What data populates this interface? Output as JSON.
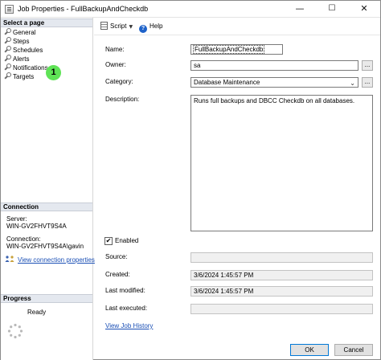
{
  "window": {
    "title": "Job Properties - FullBackupAndCheckdb",
    "minimize": "—",
    "maximize": "☐",
    "close": "✕"
  },
  "left": {
    "select_header": "Select a page",
    "pages": [
      {
        "label": "General"
      },
      {
        "label": "Steps"
      },
      {
        "label": "Schedules"
      },
      {
        "label": "Alerts"
      },
      {
        "label": "Notifications"
      },
      {
        "label": "Targets"
      }
    ],
    "badge": "1",
    "connection_header": "Connection",
    "server_label": "Server:",
    "server_value": "WIN-GV2FHVT9S4A",
    "connection_label": "Connection:",
    "connection_value": "WIN-GV2FHVT9S4A\\gavin",
    "view_connection": "View connection properties",
    "progress_header": "Progress",
    "progress_status": "Ready"
  },
  "toolbar": {
    "script": "Script",
    "help": "Help"
  },
  "form": {
    "name_label": "Name:",
    "name_value": "FullBackupAndCheckdb",
    "owner_label": "Owner:",
    "owner_value": "sa",
    "category_label": "Category:",
    "category_value": "Database Maintenance",
    "description_label": "Description:",
    "description_value": "Runs full backups and DBCC Checkdb on all databases.",
    "enabled_label": "Enabled",
    "enabled_checked": true,
    "enabled_mark": "✔",
    "source_label": "Source:",
    "source_value": "",
    "created_label": "Created:",
    "created_value": "3/6/2024 1:45:57 PM",
    "modified_label": "Last modified:",
    "modified_value": "3/6/2024 1:45:57 PM",
    "executed_label": "Last executed:",
    "executed_value": "",
    "history_link": "View Job History",
    "ellipsis": "..."
  },
  "buttons": {
    "ok": "OK",
    "cancel": "Cancel"
  }
}
